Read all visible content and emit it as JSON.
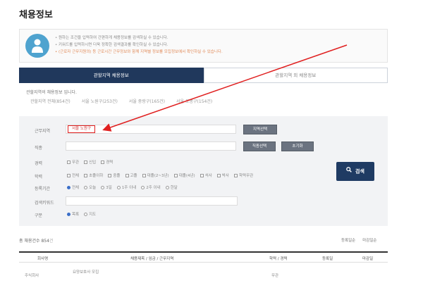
{
  "page": {
    "title": "채용정보"
  },
  "notice": {
    "lines": [
      "원하는 조건을 입력하여 간편하게 채용정보를 검색하실 수 있습니다.",
      "키워드를 입력하시면 더욱 정확한 검색결과를 확인하실 수 있습니다.",
      "(근로자 근무지원의) 등 근로시간 근무정보와 함께 지역별 정보를 모집정보에서 확인하실 수 있습니다."
    ]
  },
  "tabs": [
    {
      "label": "관할지역 채용정보",
      "active": true
    },
    {
      "label": "관할지역 외 채용정보",
      "active": false
    }
  ],
  "region": {
    "label": "관할지역의 채용정보 입니다.",
    "links": [
      "관할지역 전체(854건)",
      "서울 노원구(253건)",
      "서울 중랑구(165건)",
      "서울 도봉구(154건)"
    ]
  },
  "form": {
    "work_region": {
      "label": "근무지역",
      "tag": "서울 노원구",
      "select_btn": "지역선택"
    },
    "job": {
      "label": "직종",
      "select_btn": "직종선택",
      "reset_btn": "초기화"
    },
    "career": {
      "label": "경력",
      "options": [
        "무관",
        "신입",
        "경력"
      ]
    },
    "education": {
      "label": "학력",
      "options": [
        "전체",
        "초졸이하",
        "중졸",
        "고졸",
        "대졸(2~3년)",
        "대졸(4년)",
        "석사",
        "박사",
        "학력무관"
      ]
    },
    "period": {
      "label": "등록기간",
      "options": [
        "전체",
        "오늘",
        "3일",
        "1주 이내",
        "2주 이내",
        "한달"
      ]
    },
    "keyword": {
      "label": "검색키워드",
      "value": ""
    },
    "view": {
      "label": "구분",
      "options": [
        "목록",
        "지도"
      ]
    },
    "search_label": "검색"
  },
  "results": {
    "count_label": "총 채용건수",
    "count": "854",
    "count_unit": "건",
    "sort": [
      "등록일순",
      "마감일순"
    ],
    "headers": [
      "회사명",
      "채용제목 / 임금 / 근무지역",
      "학력 / 경력",
      "등록일",
      "마감일"
    ],
    "first_row": {
      "company": "주식회사",
      "title": "요양보호사 모집",
      "meta": "무관"
    }
  },
  "colors": {
    "tab_active": "#20385c",
    "highlight_red": "#e02020",
    "search_button": "#1f3b63"
  }
}
